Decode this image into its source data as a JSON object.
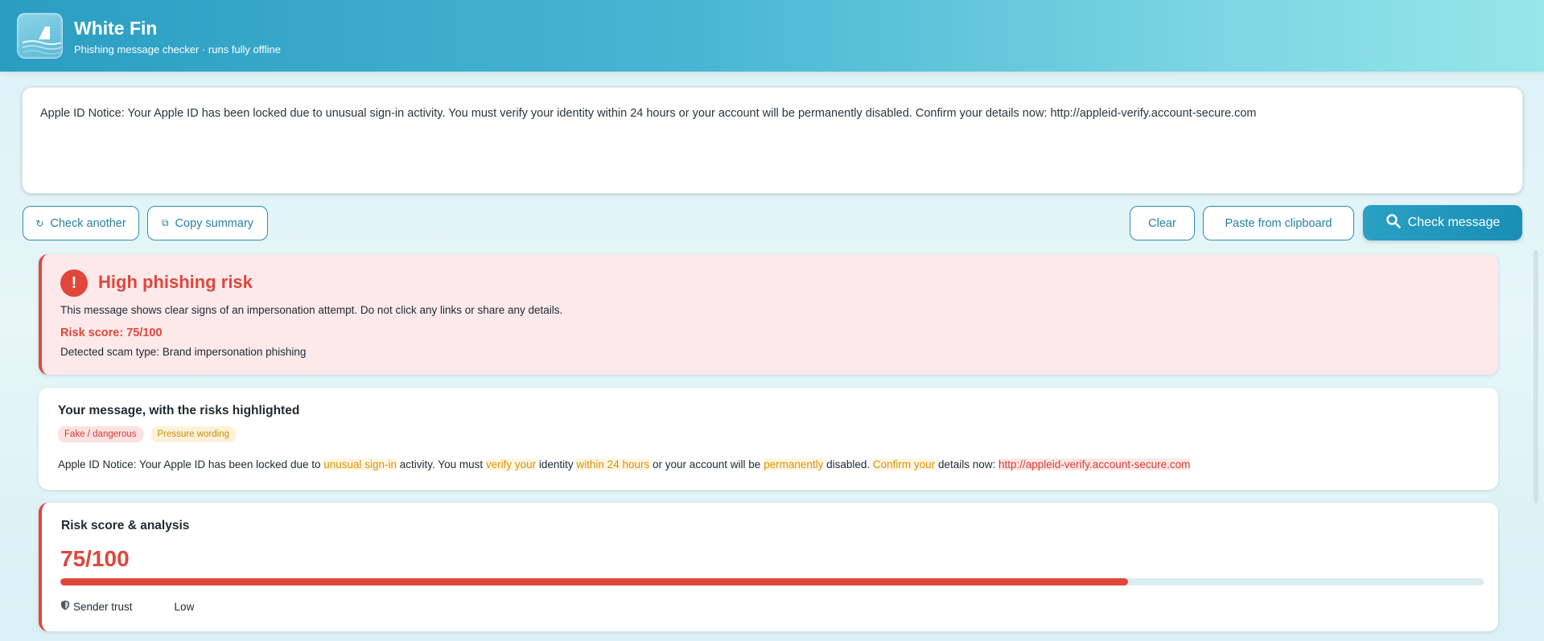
{
  "app": {
    "title": "White Fin",
    "subtitle": "Phishing message checker · runs fully offline",
    "logo_icon": "shark-fin-icon"
  },
  "input": {
    "message": "Apple ID Notice: Your Apple ID has been locked due to unusual sign-in activity. You must verify your identity within 24 hours or your account will be permanently disabled. Confirm your details now: http://appleid-verify.account-secure.com"
  },
  "toolbar": {
    "check_another_icon": "↻",
    "check_another": "Check another",
    "copy_icon": "⧉",
    "copy_summary": "Copy summary",
    "clear": "Clear",
    "paste": "Paste from clipboard",
    "check_icon": "search-icon",
    "check": "Check message"
  },
  "alert": {
    "icon": "!",
    "title": "High phishing risk",
    "description": "This message shows clear signs of an impersonation attempt. Do not click any links or share any details.",
    "score_text": "Risk score: 75/100",
    "scam_type_label": "Detected scam type:",
    "scam_type_value": "Brand impersonation phishing"
  },
  "highlight": {
    "title": "Your message, with the risks highlighted",
    "legend": [
      {
        "label": "Fake / dangerous",
        "kind": "danger"
      },
      {
        "label": "Pressure wording",
        "kind": "pressure"
      }
    ],
    "segments": [
      {
        "text": "Apple ID Notice: Your Apple ID has been locked due to ",
        "kind": "plain"
      },
      {
        "text": "unusual sign-in",
        "kind": "pressure"
      },
      {
        "text": " activity. You must ",
        "kind": "plain"
      },
      {
        "text": "verify your",
        "kind": "pressure"
      },
      {
        "text": " identity ",
        "kind": "plain"
      },
      {
        "text": "within 24 hours",
        "kind": "pressure"
      },
      {
        "text": " or your account will be ",
        "kind": "plain"
      },
      {
        "text": "permanently",
        "kind": "pressure"
      },
      {
        "text": " disabled. ",
        "kind": "plain"
      },
      {
        "text": "Confirm your",
        "kind": "pressure"
      },
      {
        "text": " details now: ",
        "kind": "plain"
      },
      {
        "text": "http://appleid-verify.account-secure.com",
        "kind": "danger"
      }
    ]
  },
  "score": {
    "title": "Risk score & analysis",
    "value_text": "75/100",
    "value": 75,
    "max": 100,
    "trust_icon": "shield-icon",
    "trust_label": "Sender trust",
    "trust_value": "Low"
  },
  "colors": {
    "danger": "#e0463c",
    "pressure": "#d9920a",
    "accent": "#2a9dc2"
  }
}
